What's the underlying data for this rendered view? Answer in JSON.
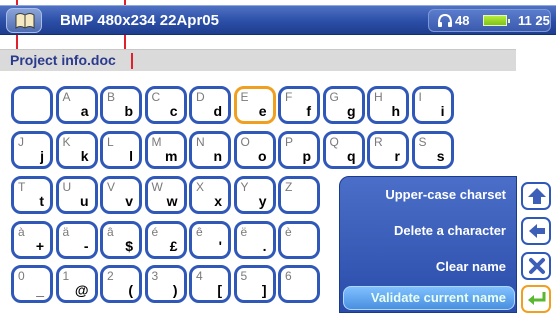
{
  "window": {
    "title": "BMP 480x234 22Apr05"
  },
  "status": {
    "volume": "48",
    "time": "11 25",
    "headphone_icon": "headphones-icon",
    "battery_icon": "battery-icon"
  },
  "name_field": {
    "value": "Project info.doc"
  },
  "keyboard": {
    "rows": [
      [
        [
          "",
          ""
        ],
        [
          "A",
          "a"
        ],
        [
          "B",
          "b"
        ],
        [
          "C",
          "c"
        ],
        [
          "D",
          "d"
        ],
        [
          "E",
          "e"
        ],
        [
          "F",
          "f"
        ],
        [
          "G",
          "g"
        ],
        [
          "H",
          "h"
        ],
        [
          "I",
          "i"
        ]
      ],
      [
        [
          "J",
          "j"
        ],
        [
          "K",
          "k"
        ],
        [
          "L",
          "l"
        ],
        [
          "M",
          "m"
        ],
        [
          "N",
          "n"
        ],
        [
          "O",
          "o"
        ],
        [
          "P",
          "p"
        ],
        [
          "Q",
          "q"
        ],
        [
          "R",
          "r"
        ],
        [
          "S",
          "s"
        ]
      ],
      [
        [
          "T",
          "t"
        ],
        [
          "U",
          "u"
        ],
        [
          "V",
          "v"
        ],
        [
          "W",
          "w"
        ],
        [
          "X",
          "x"
        ],
        [
          "Y",
          "y"
        ],
        [
          "Z",
          ""
        ]
      ],
      [
        [
          "à",
          "+"
        ],
        [
          "ä",
          "-"
        ],
        [
          "â",
          "$"
        ],
        [
          "é",
          "£"
        ],
        [
          "ê",
          "'"
        ],
        [
          "ë",
          "."
        ],
        [
          "è",
          ""
        ]
      ],
      [
        [
          "0",
          "_"
        ],
        [
          "1",
          "@"
        ],
        [
          "2",
          "("
        ],
        [
          "3",
          ")"
        ],
        [
          "4",
          "["
        ],
        [
          "5",
          "]"
        ],
        [
          "6",
          ""
        ]
      ]
    ],
    "focused_key": "E"
  },
  "menu": {
    "items": [
      {
        "label": "Upper-case charset",
        "icon": "arrow-up-icon"
      },
      {
        "label": "Delete a character",
        "icon": "arrow-left-icon"
      },
      {
        "label": "Clear name",
        "icon": "close-icon"
      },
      {
        "label": "Validate current name",
        "icon": "enter-icon"
      }
    ],
    "selected_index": 3
  },
  "colors": {
    "accent": "#2f58b8",
    "focus": "#f0a020",
    "title_bar": "#2b4ea6",
    "callout": "#e0202a"
  }
}
